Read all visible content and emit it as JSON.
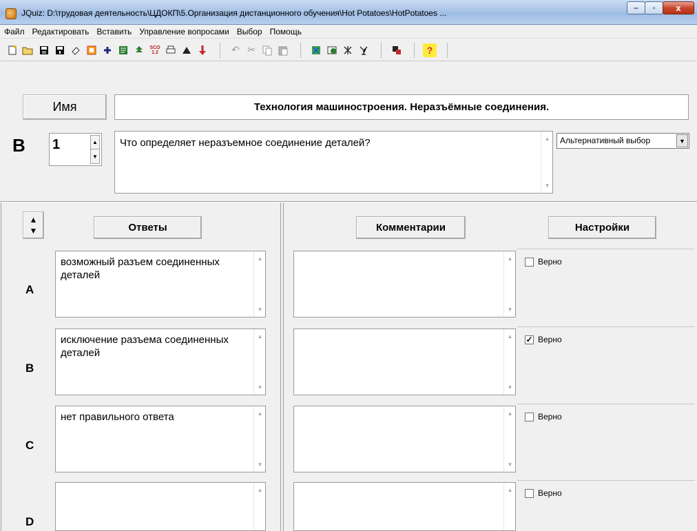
{
  "window": {
    "title": "JQuiz: D:\\трудовая деятельность\\ЦДОКП\\5.Организация дистанционного обучения\\Hot Potatoes\\HotPotatoes ...",
    "minimize": "‒",
    "maximize": "▫",
    "close": "x"
  },
  "menu": [
    "Файл",
    "Редактировать",
    "Вставить",
    "Управление вопросами",
    "Выбор",
    "Помощь"
  ],
  "toolbar": {
    "group1": [
      "new-file-icon",
      "open-folder-icon",
      "save-icon",
      "save-as-icon",
      "eraser-icon",
      "frame-icon",
      "plus-icon",
      "web-page-icon",
      "tree-icon",
      "scorm-icon",
      "print-icon",
      "export-icon",
      "red-arrow-icon"
    ],
    "group2": [
      "undo-icon",
      "cut-icon",
      "copy-icon",
      "paste-icon"
    ],
    "group3": [
      "config-icon",
      "web-export-icon",
      "hotpot-icon",
      "network-icon"
    ],
    "group4": [
      "settings-icon"
    ],
    "group5": [
      "help-icon"
    ]
  },
  "header": {
    "name_label": "Имя",
    "quiz_title": "Технология машиностроения. Неразъёмные соединения.",
    "question_letter": "В",
    "question_number": "1",
    "question_text": "Что определяет неразъемное соединение деталей?",
    "question_type": "Альтернативный выбор"
  },
  "columns": {
    "answers": "Ответы",
    "comments": "Комментарии",
    "settings": "Настройки"
  },
  "answers": [
    {
      "letter": "A",
      "text": "возможный разъем соединенных деталей",
      "comment": "",
      "correct_label": "Верно",
      "correct": false
    },
    {
      "letter": "B",
      "text": "исключение разъема соединенных деталей",
      "comment": "",
      "correct_label": "Верно",
      "correct": true
    },
    {
      "letter": "C",
      "text": "нет правильного ответа",
      "comment": "",
      "correct_label": "Верно",
      "correct": false
    },
    {
      "letter": "D",
      "text": "",
      "comment": "",
      "correct_label": "Верно",
      "correct": false
    }
  ]
}
